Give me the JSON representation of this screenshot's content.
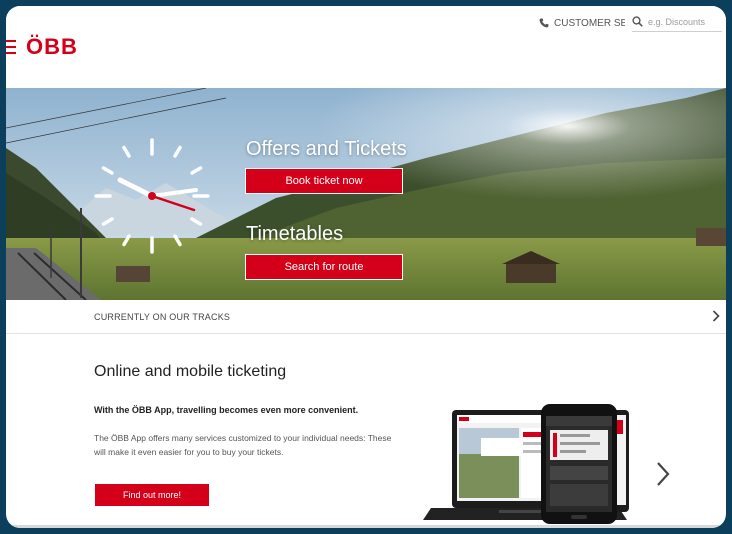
{
  "header": {
    "brand": "ÖBB",
    "customer_service": "CUSTOMER SERVICE",
    "search_placeholder": "e.g. Discounts"
  },
  "hero": {
    "offers_title": "Offers and Tickets",
    "book_button": "Book ticket now",
    "timetables_title": "Timetables",
    "search_button": "Search for route"
  },
  "tracks": {
    "label": "CURRENTLY ON OUR TRACKS"
  },
  "ticketing": {
    "title": "Online and mobile ticketing",
    "lead": "With the ÖBB App, travelling becomes even more convenient.",
    "body": "The ÖBB App offers many services customized to your individual needs: These will make it even easier for you to buy your tickets.",
    "button": "Find out more!"
  },
  "colors": {
    "brand_red": "#d4001a",
    "frame_background": "#0b3f5c"
  },
  "icons": [
    "menu-icon",
    "phone-icon",
    "search-icon",
    "clock-icon",
    "chevron-right-icon"
  ]
}
